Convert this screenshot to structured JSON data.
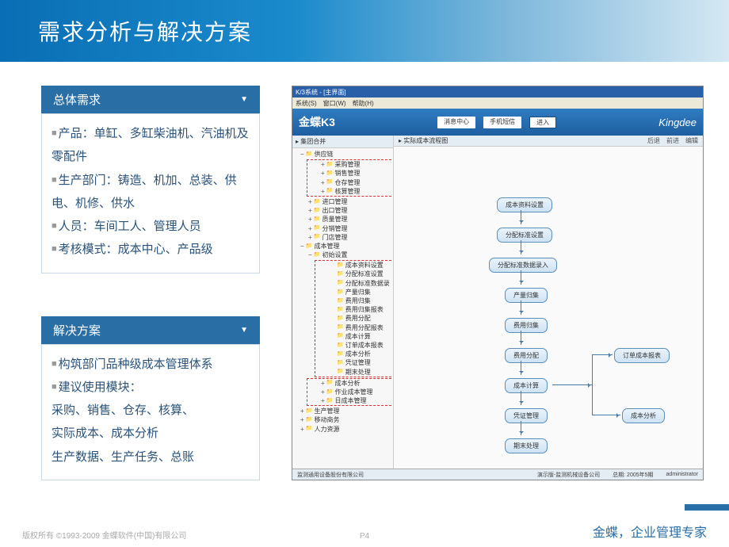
{
  "slide": {
    "title": "需求分析与解决方案",
    "page": "P4",
    "copyright": "版权所有 ©1993-2009 金蝶软件(中国)有限公司",
    "tagline": "金蝶，企业管理专家"
  },
  "section1": {
    "heading": "总体需求",
    "items": [
      "产品：单缸、多缸柴油机、汽油机及零配件",
      "生产部门：铸造、机加、总装、供电、机修、供水",
      "人员：车间工人、管理人员",
      "考核模式：成本中心、产品级"
    ]
  },
  "section2": {
    "heading": "解决方案",
    "items": [
      "构筑部门品种级成本管理体系",
      "建议使用模块："
    ],
    "lines": [
      "采购、销售、仓存、核算、",
      "实际成本、成本分析",
      "生产数据、生产任务、总账"
    ]
  },
  "app": {
    "title": "K/3系统 - [主界面]",
    "menus": [
      "系统(S)",
      "窗口(W)",
      "帮助(H)"
    ],
    "logo": "金蝶K3",
    "brand": "Kingdee",
    "midbtns": [
      "消息中心",
      "手机短信"
    ],
    "go": "进入",
    "tree_hdr": "集团合并",
    "tree": {
      "root": "供应链",
      "group1": [
        "采购管理",
        "销售管理",
        "仓存管理",
        "核算管理"
      ],
      "simple": [
        "进口管理",
        "出口管理",
        "质量管理",
        "分销管理",
        "门店管理"
      ],
      "cb_root": "成本管理",
      "cb_first": "初始设置",
      "group2": [
        "成本资料设置",
        "分配标准设置",
        "分配标准数据录",
        "产量归集",
        "费用归集",
        "费用归集报表",
        "费用分配",
        "费用分配报表",
        "成本计算",
        "订单成本报表",
        "成本分析",
        "凭证管理",
        "期末处理"
      ],
      "tail": [
        "成本分析",
        "作业成本管理",
        "日成本管理"
      ],
      "extra": [
        "生产管理",
        "移动商务",
        "人力资源"
      ]
    },
    "flow_tab": "实际成本流程图",
    "flow_right": [
      "后退",
      "前进",
      "编辑"
    ],
    "boxes": [
      "成本资料设置",
      "分配标准设置",
      "分配标准数据录入",
      "产量归集",
      "费用归集",
      "费用分配",
      "成本计算",
      "凭证管理",
      "期末处理",
      "订单成本报表",
      "成本分析"
    ],
    "status": {
      "company": "监测通用设备股份有限公司",
      "acct": "演示版-监测机械设备公司",
      "period": "总期: 2005年5期",
      "user": "administrator"
    }
  }
}
